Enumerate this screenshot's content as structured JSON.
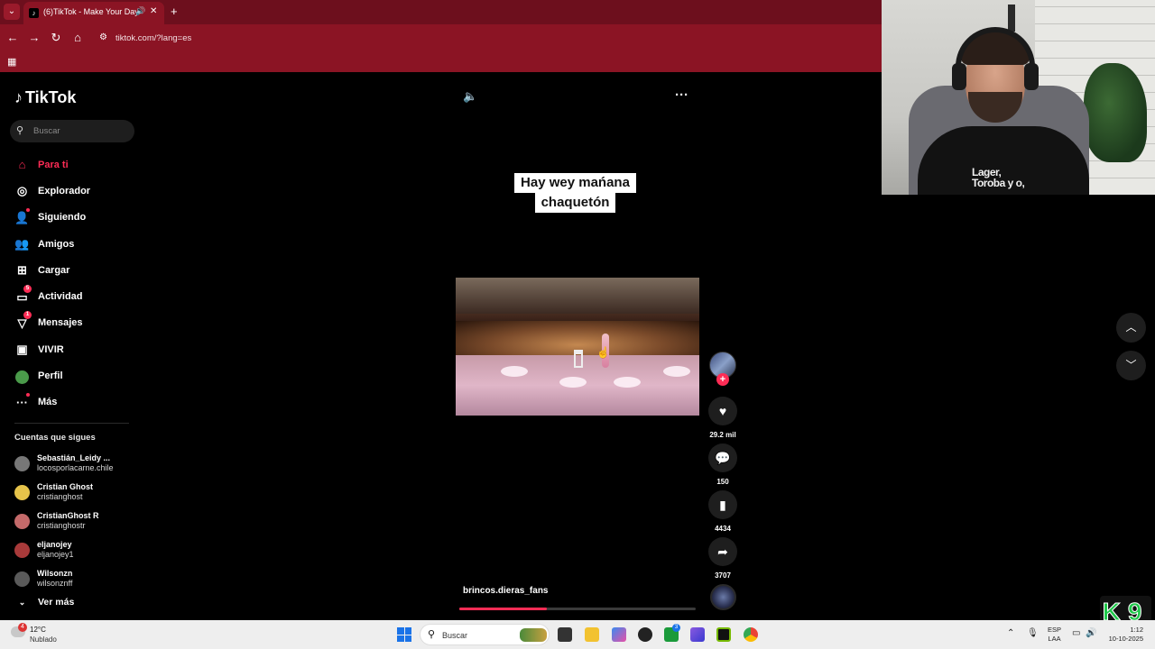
{
  "browser": {
    "tab_title": "(6)TikTok - Make Your Day",
    "url": "tiktok.com/?lang=es"
  },
  "tiktok": {
    "brand": "TikTok",
    "search_placeholder": "Buscar",
    "nav": [
      {
        "label": "Para ti",
        "icon": "home-icon",
        "active": true
      },
      {
        "label": "Explorador",
        "icon": "compass-icon"
      },
      {
        "label": "Siguiendo",
        "icon": "user-follow-icon"
      },
      {
        "label": "Amigos",
        "icon": "friends-icon"
      },
      {
        "label": "Cargar",
        "icon": "upload-icon"
      },
      {
        "label": "Actividad",
        "icon": "activity-icon",
        "badge": "5"
      },
      {
        "label": "Mensajes",
        "icon": "messages-icon",
        "badge": "1"
      },
      {
        "label": "VIVIR",
        "icon": "live-icon"
      },
      {
        "label": "Perfil",
        "icon": "profile-icon"
      },
      {
        "label": "Más",
        "icon": "more-icon"
      }
    ],
    "following_title": "Cuentas que sigues",
    "following": [
      {
        "name": "Sebastián_Leidy ...",
        "handle": "locosporlacarne.chile"
      },
      {
        "name": "Cristian Ghost",
        "handle": "cristianghost"
      },
      {
        "name": "CristianGhost R",
        "handle": "cristianghostr"
      },
      {
        "name": "eljanojey",
        "handle": "eljanojey1"
      },
      {
        "name": "Wilsonzn",
        "handle": "wilsonznff"
      }
    ],
    "see_more": "Ver más",
    "video": {
      "caption_line1": "Hay wey  mańana",
      "caption_line2": "chaquetón",
      "author": "brincos.dieras_fans",
      "progress_fraction": 0.37
    },
    "actions": {
      "likes": "29.2 mil",
      "comments": "150",
      "saves": "4434",
      "shares": "3707"
    }
  },
  "webcam": {
    "shirt_text_line1": "Lager,",
    "shirt_text_line2": "Toroba y o,"
  },
  "overlay_logo": "K9",
  "taskbar": {
    "weather_badge": "4",
    "temperature": "12°C",
    "condition": "Nublado",
    "search_placeholder": "Buscar",
    "lang_line1": "ESP",
    "lang_line2": "LAA",
    "time": "1:12",
    "date": "10-10-2025",
    "app_badge": "3"
  },
  "colors": {
    "browser_frame": "#8b1424",
    "tiktok_accent": "#fe2c55",
    "background": "#000000"
  }
}
